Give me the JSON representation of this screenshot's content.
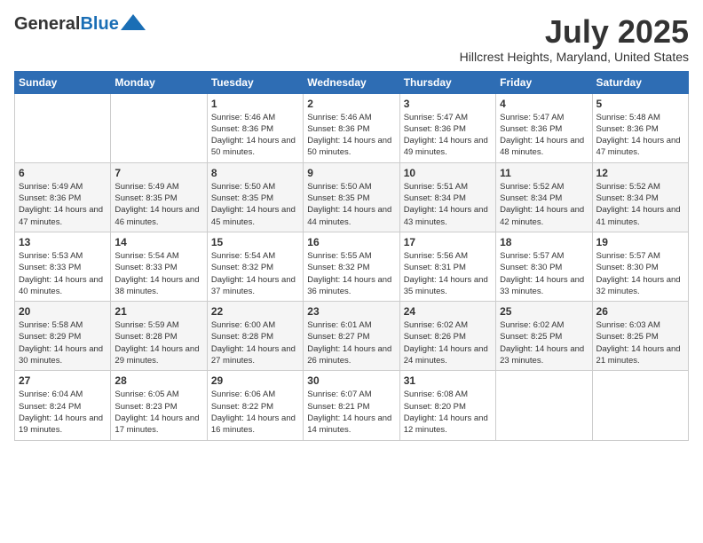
{
  "logo": {
    "line1": "General",
    "line2": "Blue"
  },
  "title": "July 2025",
  "subtitle": "Hillcrest Heights, Maryland, United States",
  "weekdays": [
    "Sunday",
    "Monday",
    "Tuesday",
    "Wednesday",
    "Thursday",
    "Friday",
    "Saturday"
  ],
  "weeks": [
    [
      {
        "day": "",
        "info": ""
      },
      {
        "day": "",
        "info": ""
      },
      {
        "day": "1",
        "info": "Sunrise: 5:46 AM\nSunset: 8:36 PM\nDaylight: 14 hours and 50 minutes."
      },
      {
        "day": "2",
        "info": "Sunrise: 5:46 AM\nSunset: 8:36 PM\nDaylight: 14 hours and 50 minutes."
      },
      {
        "day": "3",
        "info": "Sunrise: 5:47 AM\nSunset: 8:36 PM\nDaylight: 14 hours and 49 minutes."
      },
      {
        "day": "4",
        "info": "Sunrise: 5:47 AM\nSunset: 8:36 PM\nDaylight: 14 hours and 48 minutes."
      },
      {
        "day": "5",
        "info": "Sunrise: 5:48 AM\nSunset: 8:36 PM\nDaylight: 14 hours and 47 minutes."
      }
    ],
    [
      {
        "day": "6",
        "info": "Sunrise: 5:49 AM\nSunset: 8:36 PM\nDaylight: 14 hours and 47 minutes."
      },
      {
        "day": "7",
        "info": "Sunrise: 5:49 AM\nSunset: 8:35 PM\nDaylight: 14 hours and 46 minutes."
      },
      {
        "day": "8",
        "info": "Sunrise: 5:50 AM\nSunset: 8:35 PM\nDaylight: 14 hours and 45 minutes."
      },
      {
        "day": "9",
        "info": "Sunrise: 5:50 AM\nSunset: 8:35 PM\nDaylight: 14 hours and 44 minutes."
      },
      {
        "day": "10",
        "info": "Sunrise: 5:51 AM\nSunset: 8:34 PM\nDaylight: 14 hours and 43 minutes."
      },
      {
        "day": "11",
        "info": "Sunrise: 5:52 AM\nSunset: 8:34 PM\nDaylight: 14 hours and 42 minutes."
      },
      {
        "day": "12",
        "info": "Sunrise: 5:52 AM\nSunset: 8:34 PM\nDaylight: 14 hours and 41 minutes."
      }
    ],
    [
      {
        "day": "13",
        "info": "Sunrise: 5:53 AM\nSunset: 8:33 PM\nDaylight: 14 hours and 40 minutes."
      },
      {
        "day": "14",
        "info": "Sunrise: 5:54 AM\nSunset: 8:33 PM\nDaylight: 14 hours and 38 minutes."
      },
      {
        "day": "15",
        "info": "Sunrise: 5:54 AM\nSunset: 8:32 PM\nDaylight: 14 hours and 37 minutes."
      },
      {
        "day": "16",
        "info": "Sunrise: 5:55 AM\nSunset: 8:32 PM\nDaylight: 14 hours and 36 minutes."
      },
      {
        "day": "17",
        "info": "Sunrise: 5:56 AM\nSunset: 8:31 PM\nDaylight: 14 hours and 35 minutes."
      },
      {
        "day": "18",
        "info": "Sunrise: 5:57 AM\nSunset: 8:30 PM\nDaylight: 14 hours and 33 minutes."
      },
      {
        "day": "19",
        "info": "Sunrise: 5:57 AM\nSunset: 8:30 PM\nDaylight: 14 hours and 32 minutes."
      }
    ],
    [
      {
        "day": "20",
        "info": "Sunrise: 5:58 AM\nSunset: 8:29 PM\nDaylight: 14 hours and 30 minutes."
      },
      {
        "day": "21",
        "info": "Sunrise: 5:59 AM\nSunset: 8:28 PM\nDaylight: 14 hours and 29 minutes."
      },
      {
        "day": "22",
        "info": "Sunrise: 6:00 AM\nSunset: 8:28 PM\nDaylight: 14 hours and 27 minutes."
      },
      {
        "day": "23",
        "info": "Sunrise: 6:01 AM\nSunset: 8:27 PM\nDaylight: 14 hours and 26 minutes."
      },
      {
        "day": "24",
        "info": "Sunrise: 6:02 AM\nSunset: 8:26 PM\nDaylight: 14 hours and 24 minutes."
      },
      {
        "day": "25",
        "info": "Sunrise: 6:02 AM\nSunset: 8:25 PM\nDaylight: 14 hours and 23 minutes."
      },
      {
        "day": "26",
        "info": "Sunrise: 6:03 AM\nSunset: 8:25 PM\nDaylight: 14 hours and 21 minutes."
      }
    ],
    [
      {
        "day": "27",
        "info": "Sunrise: 6:04 AM\nSunset: 8:24 PM\nDaylight: 14 hours and 19 minutes."
      },
      {
        "day": "28",
        "info": "Sunrise: 6:05 AM\nSunset: 8:23 PM\nDaylight: 14 hours and 17 minutes."
      },
      {
        "day": "29",
        "info": "Sunrise: 6:06 AM\nSunset: 8:22 PM\nDaylight: 14 hours and 16 minutes."
      },
      {
        "day": "30",
        "info": "Sunrise: 6:07 AM\nSunset: 8:21 PM\nDaylight: 14 hours and 14 minutes."
      },
      {
        "day": "31",
        "info": "Sunrise: 6:08 AM\nSunset: 8:20 PM\nDaylight: 14 hours and 12 minutes."
      },
      {
        "day": "",
        "info": ""
      },
      {
        "day": "",
        "info": ""
      }
    ]
  ]
}
